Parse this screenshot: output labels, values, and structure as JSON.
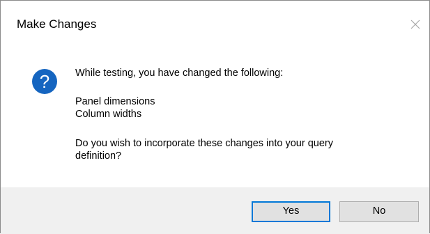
{
  "window": {
    "title": "Make Changes",
    "close_icon": "close-icon"
  },
  "message": {
    "icon": "question-icon",
    "icon_color": "#1565c0",
    "intro": "While testing, you have changed the following:",
    "changes": [
      "Panel dimensions",
      "Column widths"
    ],
    "question_line1": "Do you wish to incorporate these changes into your query",
    "question_line2": "definition?"
  },
  "buttons": {
    "yes_label": "Yes",
    "no_label": "No",
    "default_button": "Yes",
    "focus_color": "#0078d7"
  }
}
